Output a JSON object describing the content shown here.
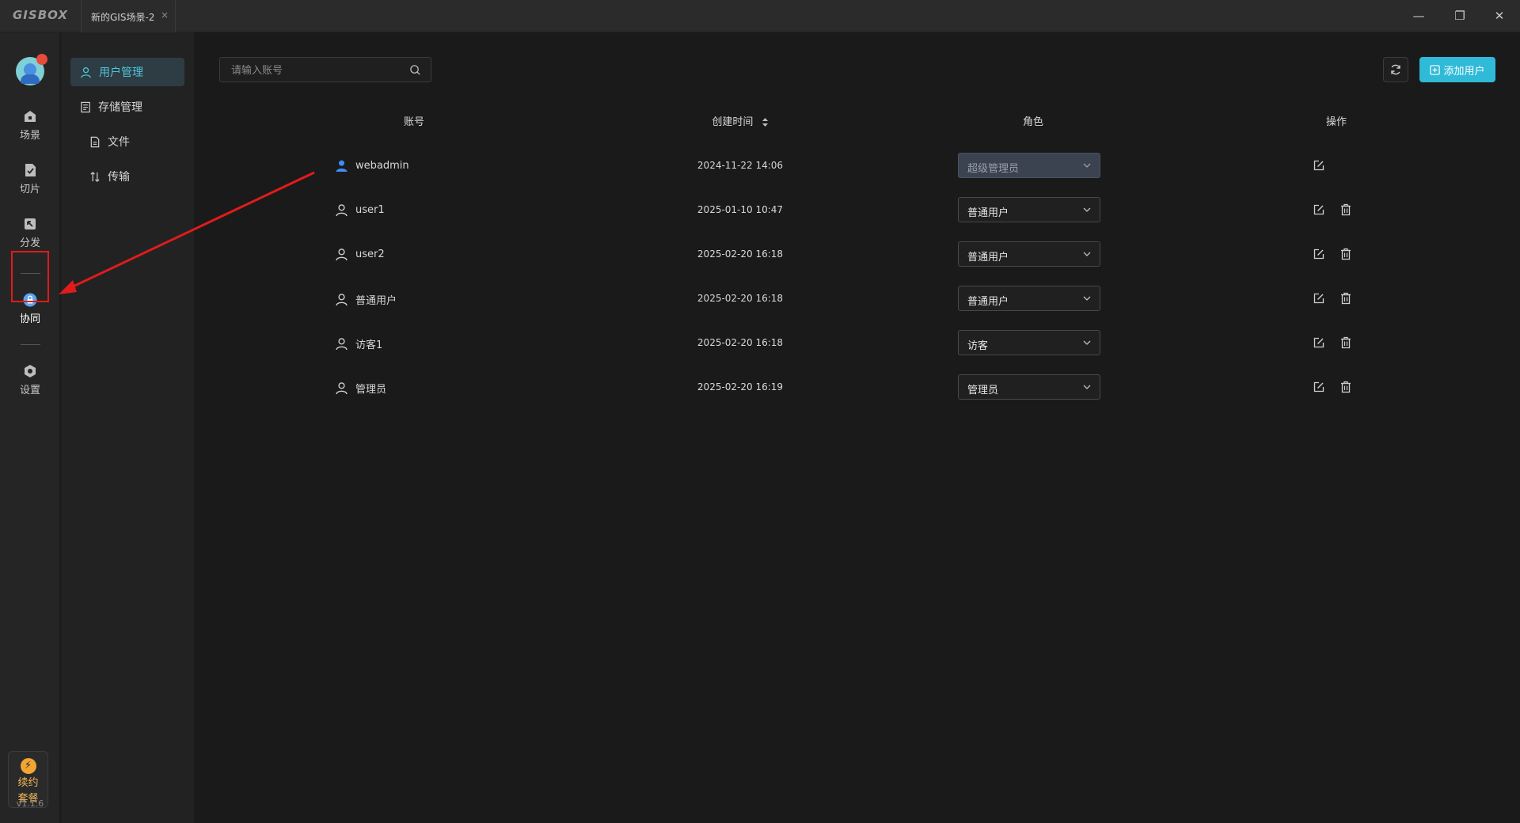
{
  "app": {
    "logo": "GISBOX",
    "tab_title": "新的GIS场景-2",
    "tab_close": "×"
  },
  "window_controls": {
    "minimize": "—",
    "restore": "❐",
    "close": "✕"
  },
  "sidebar": {
    "items": [
      {
        "label": "场景",
        "icon": "scene-icon"
      },
      {
        "label": "切片",
        "icon": "tile-icon"
      },
      {
        "label": "分发",
        "icon": "distribute-icon"
      },
      {
        "label": "协同",
        "icon": "collab-icon",
        "active": true
      },
      {
        "label": "设置",
        "icon": "settings-icon"
      }
    ],
    "renew_line1": "续约",
    "renew_line2": "套餐",
    "version": "v1.1.6"
  },
  "subnav": {
    "items": [
      {
        "label": "用户管理",
        "icon": "user-icon",
        "active": true
      },
      {
        "label": "存储管理",
        "icon": "storage-icon"
      },
      {
        "label": "文件",
        "icon": "file-icon"
      },
      {
        "label": "传输",
        "icon": "transfer-icon"
      }
    ]
  },
  "toolbar": {
    "search_placeholder": "请输入账号",
    "add_user_label": "添加用户"
  },
  "table": {
    "headers": {
      "account": "账号",
      "created": "创建时间",
      "role": "角色",
      "actions": "操作"
    },
    "rows": [
      {
        "account": "webadmin",
        "created": "2024-11-22 14:06",
        "role": "超级管理员",
        "role_disabled": true,
        "deletable": false
      },
      {
        "account": "user1",
        "created": "2025-01-10 10:47",
        "role": "普通用户",
        "deletable": true
      },
      {
        "account": "user2",
        "created": "2025-02-20 16:18",
        "role": "普通用户",
        "deletable": true
      },
      {
        "account": "普通用户",
        "created": "2025-02-20 16:18",
        "role": "普通用户",
        "deletable": true
      },
      {
        "account": "访客1",
        "created": "2025-02-20 16:18",
        "role": "访客",
        "deletable": true
      },
      {
        "account": "管理员",
        "created": "2025-02-20 16:19",
        "role": "管理员",
        "deletable": true
      }
    ]
  },
  "colors": {
    "accent": "#2fbad8",
    "annotation": "#e01b1b",
    "renew": "#f1a534"
  }
}
